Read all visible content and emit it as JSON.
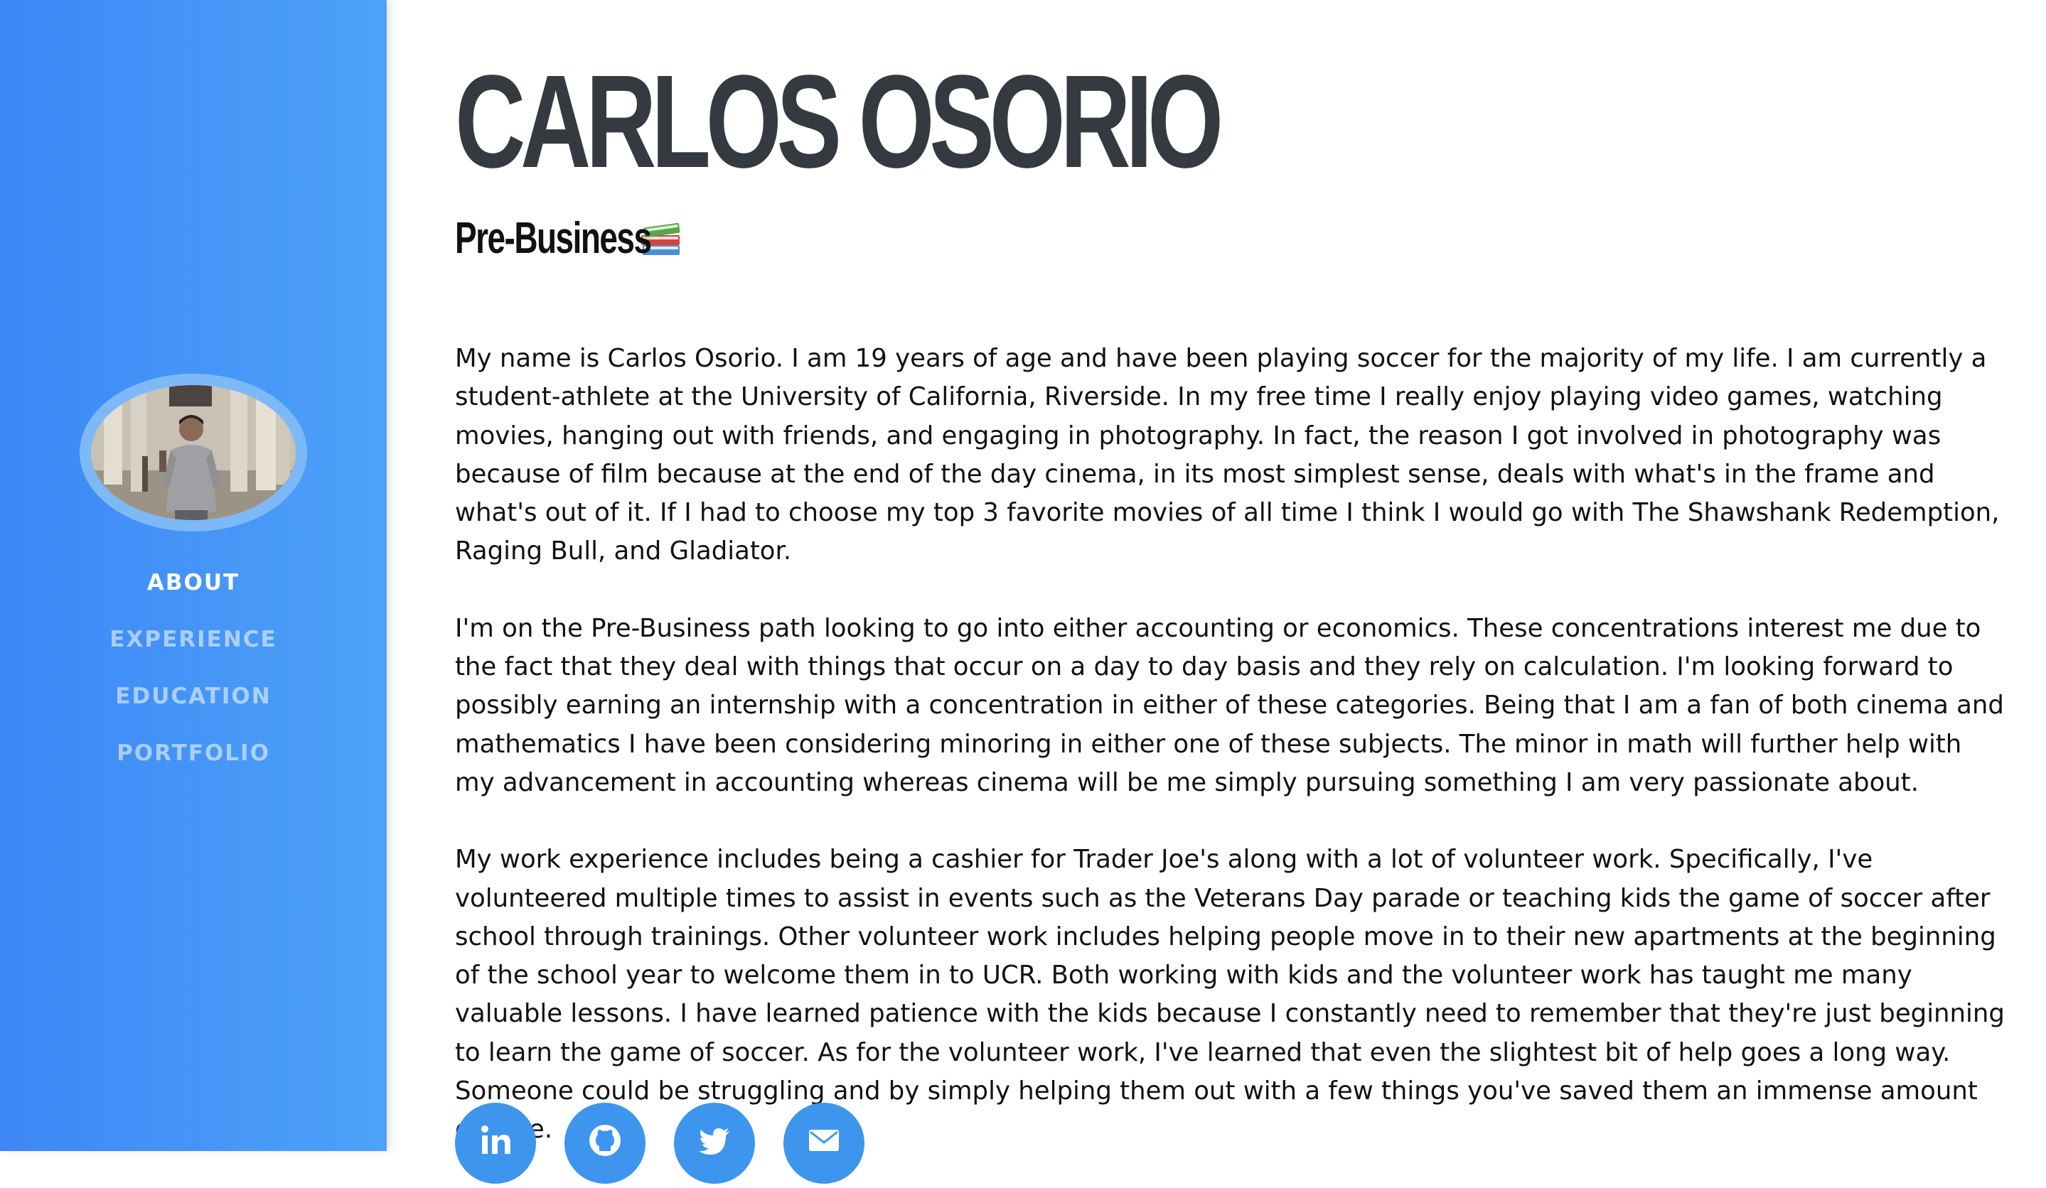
{
  "profile": {
    "name": "CARLOS OSORIO",
    "subtitle": "Pre-Business",
    "subtitle_icon": "books-icon"
  },
  "nav": {
    "items": [
      {
        "label": "ABOUT",
        "active": true
      },
      {
        "label": "EXPERIENCE",
        "active": false
      },
      {
        "label": "EDUCATION",
        "active": false
      },
      {
        "label": "PORTFOLIO",
        "active": false
      }
    ]
  },
  "bio": {
    "paragraphs": [
      "My name is Carlos Osorio. I am 19 years of age and have been playing soccer for the majority of my life. I am currently a student-athlete at the University of California, Riverside. In my free time I really enjoy playing video games, watching movies, hanging out with friends, and engaging in photography. In fact, the reason I got involved in photography was because of film because at the end of the day cinema, in its most simplest sense, deals with what's in the frame and what's out of it. If I had to choose my top 3 favorite movies of all time I think I would go with The Shawshank Redemption, Raging Bull, and Gladiator.",
      "I'm on the Pre-Business path looking to go into either accounting or economics. These concentrations interest me due to the fact that they deal with things that occur on a day to day basis and they rely on calculation. I'm looking forward to possibly earning an internship with a concentration in either of these categories. Being that I am a fan of both cinema and mathematics I have been considering minoring in either one of these subjects. The minor in math will further help with my advancement in accounting whereas cinema will be me simply pursuing something I am very passionate about.",
      "My work experience includes being a cashier for Trader Joe's along with a lot of volunteer work. Specifically, I've volunteered multiple times to assist in events such as the Veterans Day parade or teaching kids the game of soccer after school through trainings. Other volunteer work includes helping people move in to their new apartments at the beginning of the school year to welcome them in to UCR. Both working with kids and the volunteer work has taught me many valuable lessons. I have learned patience with the kids because I constantly need to remember that they're just beginning to learn the game of soccer. As for the volunteer work, I've learned that even the slightest bit of help goes a long way. Someone could be struggling and by simply helping them out with a few things you've saved them an immense amount of time."
    ]
  },
  "socials": [
    {
      "icon": "linkedin-icon"
    },
    {
      "icon": "github-icon"
    },
    {
      "icon": "twitter-icon"
    },
    {
      "icon": "email-icon"
    }
  ],
  "colors": {
    "sidebar_start": "#3d87f6",
    "sidebar_end": "#4da2f8",
    "heading": "#343a40",
    "social_bg": "#3d95ee"
  }
}
